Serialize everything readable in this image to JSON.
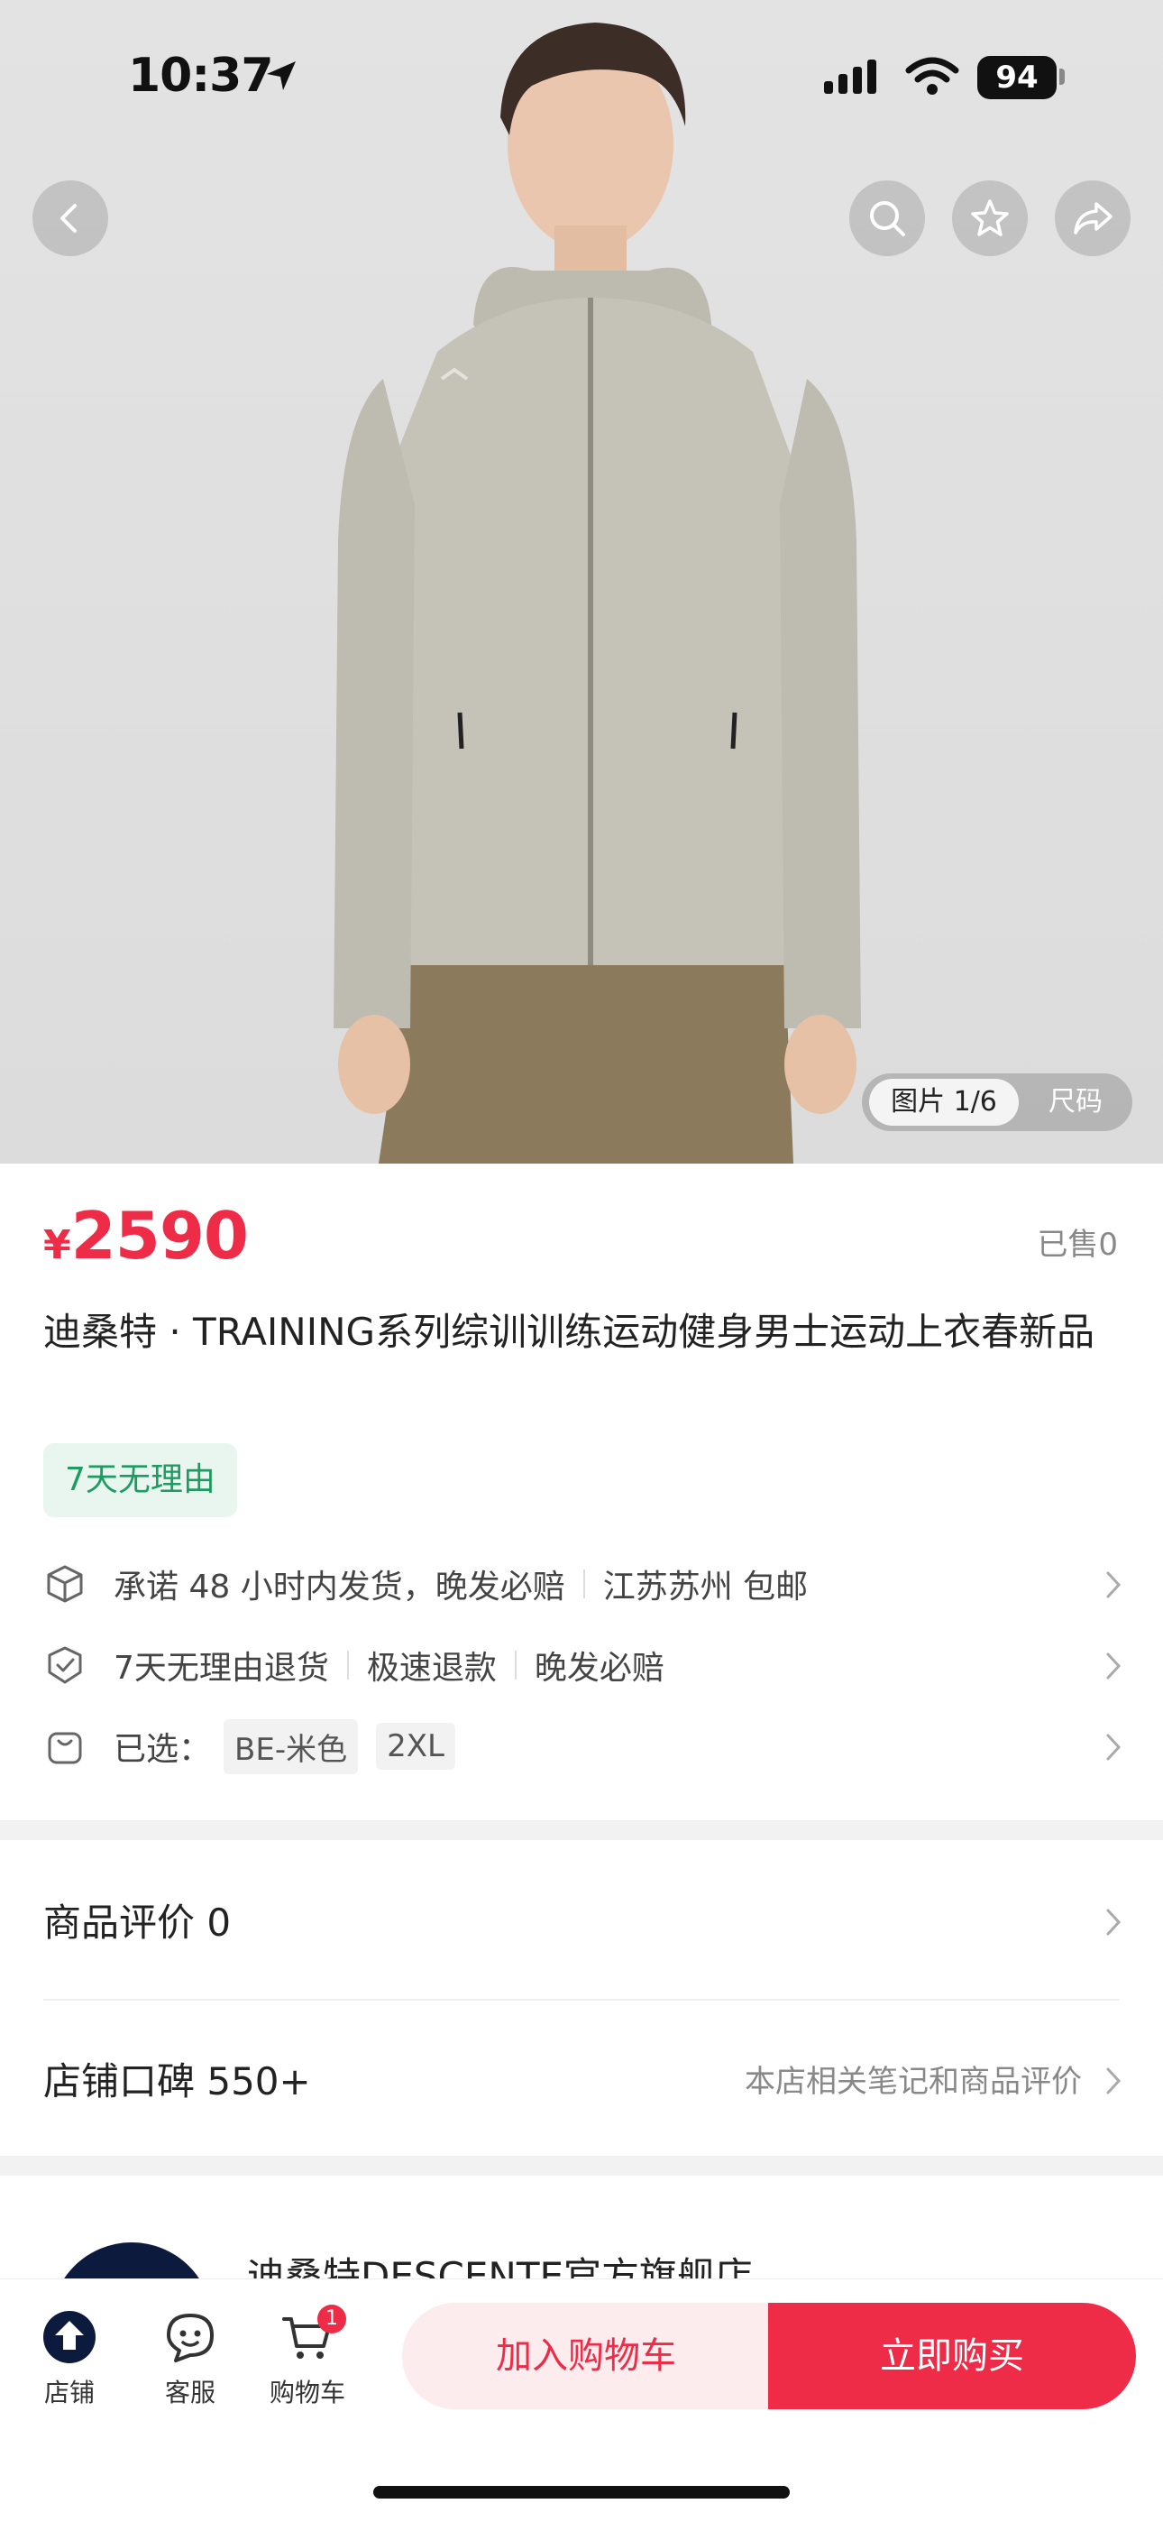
{
  "status_bar": {
    "time": "10:37",
    "battery": "94"
  },
  "image_toggle": {
    "active_label": "图片 1/6",
    "inactive_label": "尺码"
  },
  "product": {
    "price_symbol": "¥",
    "price": "2590",
    "sold": "已售0",
    "title": "迪桑特 · TRAINING系列综训训练运动健身男士运动上衣春新品",
    "tag": "7天无理由"
  },
  "services": {
    "shipping": {
      "promise": "承诺 48 小时内发货，晚发必赔",
      "location": "江苏苏州 包邮"
    },
    "returns": [
      "7天无理由退货",
      "极速退款",
      "晚发必赔"
    ],
    "selected": {
      "label": "已选：",
      "color": "BE-米色",
      "size": "2XL"
    }
  },
  "reviews": {
    "label": "商品评价 0"
  },
  "reputation": {
    "label": "店铺口碑 550+",
    "hint": "本店相关笔记和商品评价"
  },
  "store": {
    "name": "迪桑特DESCENTE官方旗舰店"
  },
  "bottom_bar": {
    "store_label": "店铺",
    "service_label": "客服",
    "cart_label": "购物车",
    "cart_count": "1",
    "add_to_cart": "加入购物车",
    "buy_now": "立即购买"
  },
  "colors": {
    "accent": "#ee2c47",
    "tag_green": "#1e9b62",
    "store_navy": "#0c1a3d"
  },
  "icons": [
    "back-icon",
    "search-icon",
    "star-icon",
    "share-icon",
    "location-arrow-icon",
    "signal-icon",
    "wifi-icon",
    "battery-icon",
    "shipping-box-icon",
    "shield-check-icon",
    "bag-icon",
    "chevron-right-icon",
    "store-icon",
    "service-chat-icon",
    "cart-icon"
  ]
}
